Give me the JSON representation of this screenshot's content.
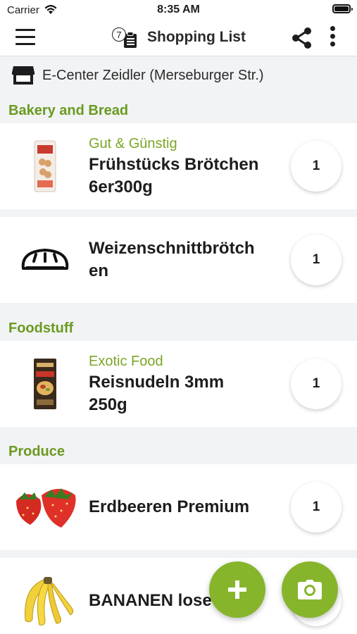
{
  "status_bar": {
    "carrier": "Carrier",
    "time": "8:35 AM"
  },
  "nav": {
    "title": "Shopping List",
    "list_count": "7"
  },
  "store": {
    "name": "E-Center Zeidler (Merseburger Str.)"
  },
  "categories": [
    {
      "name": "Bakery and Bread",
      "items": [
        {
          "brand": "Gut & Günstig",
          "name_lines": [
            "Frühstücks Brötchen",
            "6er300g"
          ],
          "quantity": "1"
        },
        {
          "brand": "",
          "name_lines": [
            "Weizenschnittbrötch",
            "en"
          ],
          "quantity": "1"
        }
      ]
    },
    {
      "name": "Foodstuff",
      "items": [
        {
          "brand": "Exotic Food",
          "name_lines": [
            "Reisnudeln 3mm",
            "250g"
          ],
          "quantity": "1"
        }
      ]
    },
    {
      "name": "Produce",
      "items": [
        {
          "brand": "",
          "name_lines": [
            "Erdbeeren Premium"
          ],
          "quantity": "1"
        },
        {
          "brand": "",
          "name_lines": [
            "BANANEN lose"
          ],
          "quantity": "1"
        }
      ]
    }
  ],
  "fab": {
    "add_icon": "plus-icon",
    "camera_icon": "camera-icon"
  },
  "colors": {
    "accent": "#86b52c",
    "category_text": "#6a9a1f",
    "brand_text": "#7aa624",
    "background": "#f2f3f5"
  }
}
